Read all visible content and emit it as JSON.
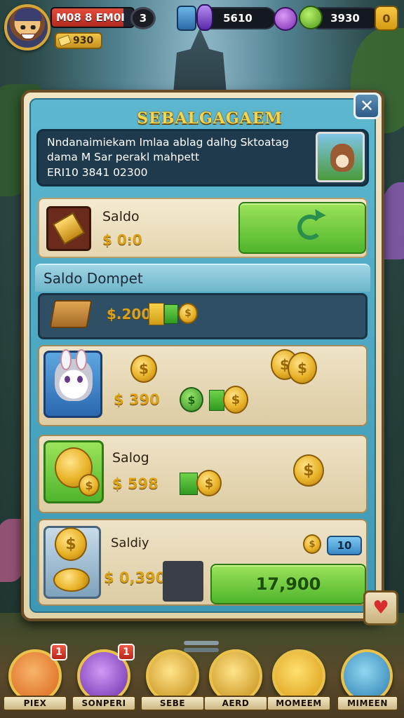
{
  "hud": {
    "player_name": "M08 8 EM0I",
    "player_level": "3",
    "gold_small": "930",
    "gems": "5610",
    "coins": "3930",
    "plus_label": "0"
  },
  "panel": {
    "title": "SEBALGAGAEM",
    "close_label": "✕",
    "notice_line1": "Nndanaimiekam Imlaa ablag dalhg Sktoatag",
    "notice_line2": "dama M Sar perakl mahpett",
    "notice_line3": "ERI10 3841 02300"
  },
  "saldo": {
    "label": "Saldo",
    "value": "$ 0:0"
  },
  "wallet": {
    "header": "Saldo Dompet",
    "amount": "$.200"
  },
  "cards": [
    {
      "tag": "",
      "value": "$ 390"
    },
    {
      "tag": "Salog",
      "value": "$ 598"
    },
    {
      "tag": "Saldiy",
      "value": "$ 0,390",
      "button": "17,900",
      "badge": "10"
    }
  ],
  "nav": [
    {
      "label": "PIEX",
      "badge": "1"
    },
    {
      "label": "SONPERI",
      "badge": "1"
    },
    {
      "label": "SEBE"
    },
    {
      "label": "AERD"
    },
    {
      "label": "MOMEEM"
    },
    {
      "label": "MIMEEN"
    }
  ],
  "colors": {
    "accent_green": "#4fb52c",
    "title_gold": "#f6d54a",
    "panel_blue": "#3d98b5",
    "coin_gold": "#e8b227"
  }
}
